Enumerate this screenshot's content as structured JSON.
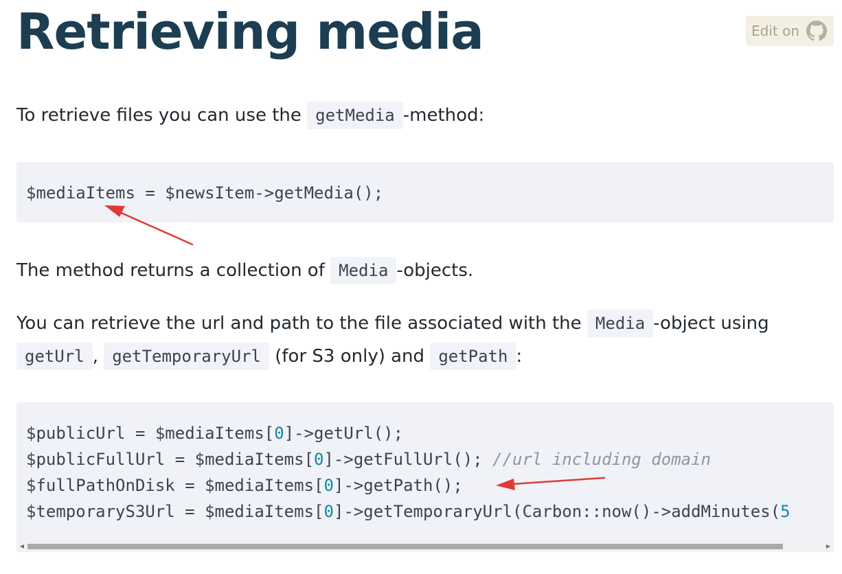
{
  "page": {
    "title": "Retrieving media",
    "edit_label": "Edit on"
  },
  "paragraphs": {
    "p1": {
      "before": "To retrieve files you can use the ",
      "code": "getMedia",
      "after": "-method:"
    },
    "p2": {
      "before": "The method returns a collection of ",
      "code": "Media",
      "after": "-objects."
    },
    "p3": {
      "line1_before": "You can retrieve the url and path to the file associated with the ",
      "line1_code": "Media",
      "line1_after": "-object using",
      "code_a": "getUrl",
      "sep_a": ", ",
      "code_b": "getTemporaryUrl",
      "mid": " (for S3 only) and ",
      "code_c": "getPath",
      "end": ":"
    }
  },
  "code1": {
    "line": "$mediaItems = $newsItem->getMedia();"
  },
  "code2": {
    "l1_a": "$publicUrl = $mediaItems[",
    "l1_num": "0",
    "l1_b": "]->getUrl();",
    "l2_a": "$publicFullUrl = $mediaItems[",
    "l2_num": "0",
    "l2_b": "]->getFullUrl(); ",
    "l2_comment": "//url including domain",
    "l3_a": "$fullPathOnDisk = $mediaItems[",
    "l3_num": "0",
    "l3_b": "]->getPath();",
    "l4_a": "$temporaryS3Url = $mediaItems[",
    "l4_num": "0",
    "l4_b": "]->getTemporaryUrl(Carbon::now()->addMinutes(",
    "l4_num2": "5"
  },
  "icons": {
    "github": "github-icon",
    "scroll_left": "chevron-left-icon",
    "scroll_right": "chevron-right-icon",
    "annotation": "red-arrow-annotation"
  },
  "colors": {
    "title": "#1c3d52",
    "code_bg": "#f1f2f8",
    "number": "#0e8a9e",
    "comment": "#8e96a0",
    "annotation_arrow": "#e03a35",
    "edit_bg": "#f3efe3"
  }
}
